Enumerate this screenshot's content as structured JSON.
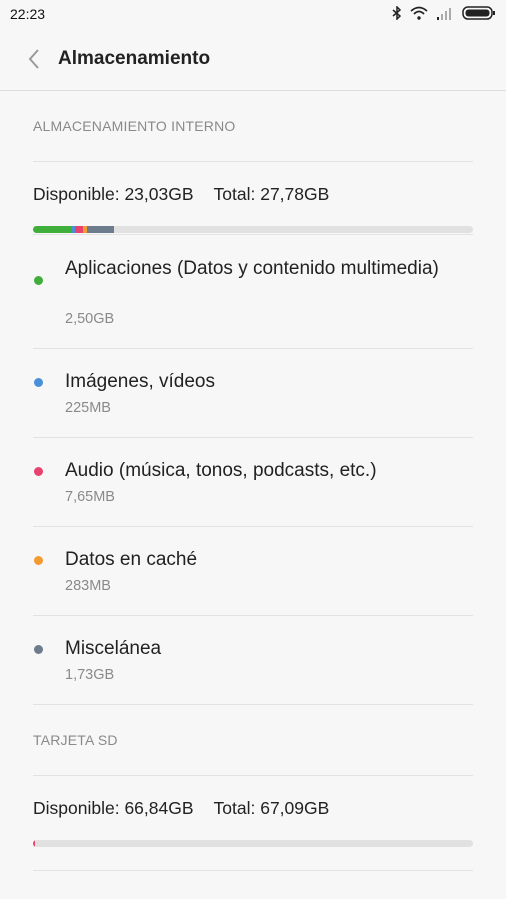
{
  "status": {
    "time": "22:23"
  },
  "appbar": {
    "title": "Almacenamiento"
  },
  "internal": {
    "header": "ALMACENAMIENTO INTERNO",
    "available": "Disponible: 23,03GB",
    "total": "Total: 27,78GB",
    "usage_bar": [
      {
        "color": "#3fae3b",
        "fraction": 0.0875
      },
      {
        "color": "#4a90d9",
        "fraction": 0.0079
      },
      {
        "color": "#e8426f",
        "fraction": 0.018
      },
      {
        "color": "#f39a33",
        "fraction": 0.0099
      },
      {
        "color": "#6c7c8c",
        "fraction": 0.0605
      }
    ],
    "items": [
      {
        "name": "Aplicaciones (Datos y contenido multimedia)",
        "size": "2,50GB",
        "color": "#3fae3b"
      },
      {
        "name": "Imágenes, vídeos",
        "size": "225MB",
        "color": "#4a90d9"
      },
      {
        "name": "Audio (música, tonos, podcasts, etc.)",
        "size": "7,65MB",
        "color": "#e8426f"
      },
      {
        "name": "Datos en caché",
        "size": "283MB",
        "color": "#f39a33"
      },
      {
        "name": "Miscelánea",
        "size": "1,73GB",
        "color": "#6c7c8c"
      }
    ]
  },
  "sd": {
    "header": "TARJETA SD",
    "available": "Disponible: 66,84GB",
    "total": "Total: 67,09GB",
    "usage_bar": [
      {
        "color": "#e8426f",
        "fraction": 0.0037
      }
    ]
  }
}
